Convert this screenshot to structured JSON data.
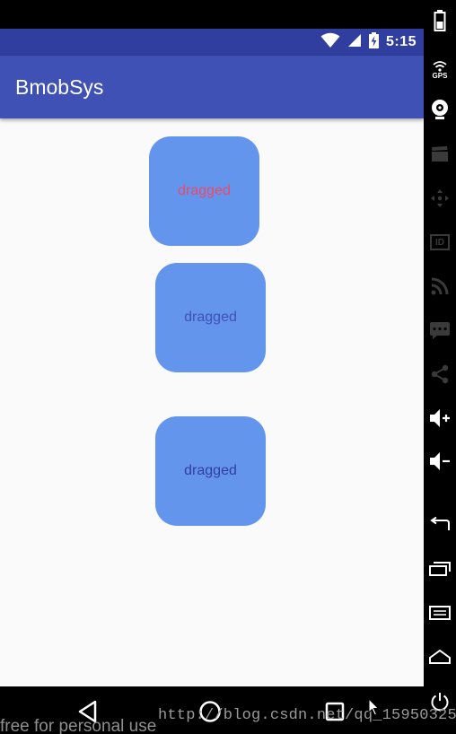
{
  "status_bar": {
    "time": "5:15"
  },
  "app_bar": {
    "title": "BmobSys"
  },
  "boxes": [
    {
      "label": "dragged",
      "text_color": "#e84a6a"
    },
    {
      "label": "dragged",
      "text_color": "#3f51b5"
    },
    {
      "label": "dragged",
      "text_color": "#303f9f"
    }
  ],
  "box_color": "#6495ed",
  "colors": {
    "primary": "#3f51b5",
    "primary_dark": "#303f9f",
    "background": "#fafafa"
  },
  "emulator_side": {
    "gps_label": "GPS",
    "id_label": "ID"
  },
  "watermark": {
    "left_text": "free for personal use",
    "url_text": "http://blog.csdn.net/qq_15950325"
  }
}
